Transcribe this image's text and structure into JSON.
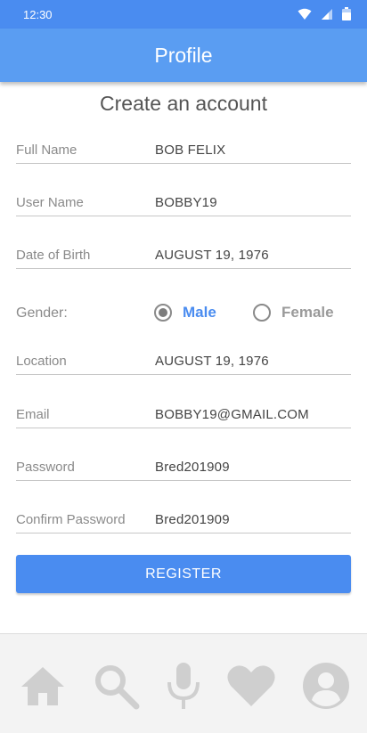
{
  "statusbar": {
    "time": "12:30"
  },
  "appbar": {
    "title": "Profile"
  },
  "form": {
    "title": "Create an account",
    "fields": [
      {
        "label": "Full Name",
        "value": "BOB FELIX"
      },
      {
        "label": "User Name",
        "value": "BOBBY19"
      },
      {
        "label": "Date of Birth",
        "value": "AUGUST 19, 1976"
      },
      {
        "label": "Location",
        "value": "AUGUST 19, 1976"
      },
      {
        "label": "Email",
        "value": "BOBBY19@GMAIL.COM"
      },
      {
        "label": "Password",
        "value": "Bred201909"
      },
      {
        "label": "Confirm Password",
        "value": "Bred201909"
      }
    ],
    "gender": {
      "label": "Gender:",
      "options": [
        {
          "label": "Male",
          "selected": true
        },
        {
          "label": "Female",
          "selected": false
        }
      ]
    },
    "register_label": "REGISTER"
  },
  "colors": {
    "primary": "#4a8cf0",
    "appbar": "#5a9df2",
    "icon_gray": "#cfcfcf"
  },
  "bottom_nav": [
    {
      "icon": "home-icon"
    },
    {
      "icon": "search-icon"
    },
    {
      "icon": "microphone-icon"
    },
    {
      "icon": "heart-icon"
    },
    {
      "icon": "account-icon"
    }
  ]
}
